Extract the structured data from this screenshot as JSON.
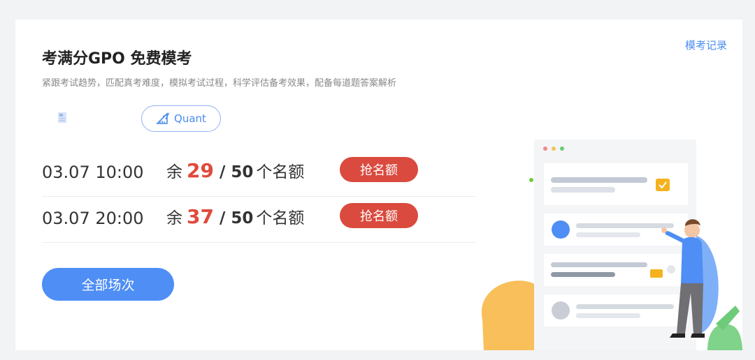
{
  "header": {
    "title": "考满分GPO 免费模考",
    "subtitle": "紧跟考试趋势，匹配真考难度，模拟考试过程，科学评估备考效果，配备每道题答案解析",
    "record_link": "模考记录"
  },
  "tabs": [
    {
      "label": "",
      "icon": "document-icon",
      "selected": false
    },
    {
      "label": "Quant",
      "icon": "ruler-triangle-icon",
      "selected": true
    }
  ],
  "sessions": [
    {
      "time": "03.07 10:00",
      "prefix": "余",
      "remaining": "29",
      "separator": "/",
      "total": "50",
      "suffix": "个名额",
      "button": "抢名额"
    },
    {
      "time": "03.07 20:00",
      "prefix": "余",
      "remaining": "37",
      "separator": "/",
      "total": "50",
      "suffix": "个名额",
      "button": "抢名额"
    }
  ],
  "all_sessions_button": "全部场次",
  "colors": {
    "accent": "#4e8ef5",
    "grab_button": "#da4a3e",
    "remaining_number": "#e04a3c",
    "link": "#4a8cf0"
  }
}
